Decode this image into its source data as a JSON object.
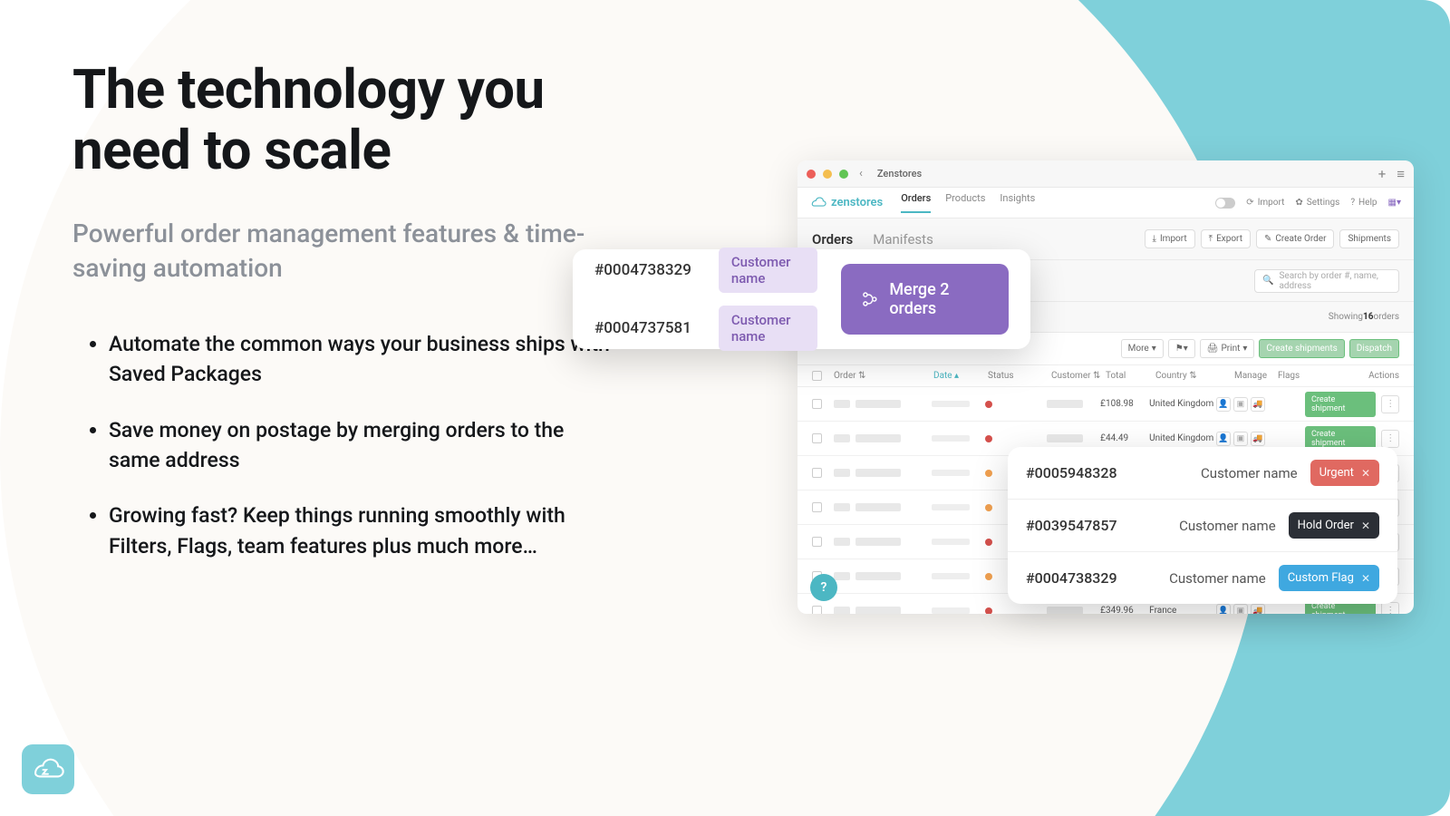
{
  "hero": {
    "title": "The technology you need to scale",
    "subtitle": "Powerful order management features & time-saving automation",
    "bullets": [
      "Automate the common ways your business ships with Saved Packages",
      "Save money on postage by merging orders to the same address",
      "Growing fast? Keep things running smoothly with Filters, Flags, team features plus much more…"
    ]
  },
  "window": {
    "title": "Zenstores",
    "brand": "zenstores",
    "nav": {
      "orders": "Orders",
      "products": "Products",
      "insights": "Insights"
    },
    "top_actions": {
      "import": "Import",
      "settings": "Settings",
      "help": "Help"
    },
    "subtabs": {
      "orders": "Orders",
      "manifests": "Manifests"
    },
    "sub_actions": {
      "import": "Import",
      "export": "Export",
      "create": "Create Order",
      "shipments": "Shipments"
    },
    "search_placeholder": "Search by order #, name, address",
    "showing_prefix": "Showing ",
    "showing_count": "16",
    "showing_suffix": " orders",
    "toolbar": {
      "more": "More",
      "print": "Print",
      "create_shipments": "Create shipments",
      "dispatch": "Dispatch"
    },
    "columns": {
      "order": "Order",
      "date": "Date",
      "status": "Status",
      "customer": "Customer",
      "total": "Total",
      "country": "Country",
      "manage": "Manage",
      "flags": "Flags",
      "actions": "Actions"
    },
    "rows": [
      {
        "total": "£108.98",
        "country": "United Kingdom"
      },
      {
        "total": "£44.49",
        "country": "United Kingdom"
      },
      {
        "total": "",
        "country": ""
      },
      {
        "total": "",
        "country": ""
      },
      {
        "total": "",
        "country": ""
      },
      {
        "total": "",
        "country": ""
      },
      {
        "total": "£349.96",
        "country": "France"
      }
    ],
    "create_shipment": "Create shipment",
    "help_fab": "?"
  },
  "merge": {
    "orders": [
      {
        "id": "#0004738329",
        "name": "Customer name"
      },
      {
        "id": "#0004737581",
        "name": "Customer name"
      }
    ],
    "button": "Merge 2 orders"
  },
  "flags": {
    "rows": [
      {
        "id": "#0005948328",
        "name": "Customer name",
        "tag": "Urgent",
        "cls": "tag-urgent"
      },
      {
        "id": "#0039547857",
        "name": "Customer name",
        "tag": "Hold Order",
        "cls": "tag-hold"
      },
      {
        "id": "#0004738329",
        "name": "Customer name",
        "tag": "Custom Flag",
        "cls": "tag-custom"
      }
    ]
  }
}
